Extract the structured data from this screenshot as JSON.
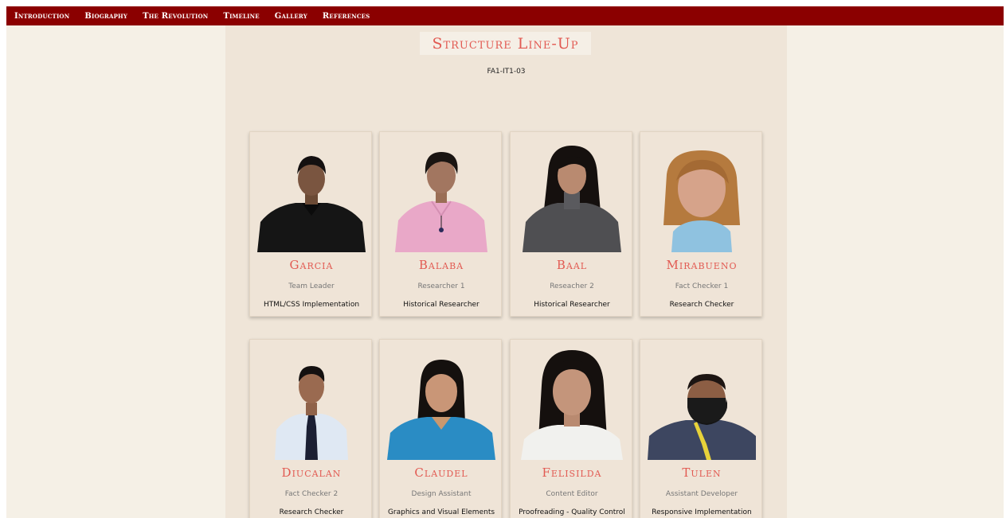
{
  "nav": {
    "items": [
      {
        "label": "Introduction"
      },
      {
        "label": "Biography"
      },
      {
        "label": "The Revolution"
      },
      {
        "label": "Timeline"
      },
      {
        "label": "Gallery"
      },
      {
        "label": "References"
      }
    ]
  },
  "header": {
    "title": "Structure Line-Up",
    "subtitle": "FA1-IT1-03"
  },
  "members": [
    {
      "name": "Garcia",
      "role": "Team Leader",
      "task": "HTML/CSS Implementation"
    },
    {
      "name": "Balaba",
      "role": "Researcher 1",
      "task": "Historical Researcher"
    },
    {
      "name": "Baal",
      "role": "Reseacher 2",
      "task": "Historical Researcher"
    },
    {
      "name": "Mirabueno",
      "role": "Fact Checker 1",
      "task": "Research Checker"
    },
    {
      "name": "Diucalan",
      "role": "Fact Checker 2",
      "task": "Research Checker"
    },
    {
      "name": "Claudel",
      "role": "Design Assistant",
      "task": "Graphics and Visual Elements"
    },
    {
      "name": "Felisilda",
      "role": "Content Editor",
      "task": "Proofreading - Quality Control"
    },
    {
      "name": "Tulen",
      "role": "Assistant Developer",
      "task": "Responsive Implementation"
    }
  ],
  "colors": {
    "nav_bg": "#8b0000",
    "accent": "#e25a52",
    "page_bg": "#f5f0e6",
    "panel_bg": "#efe5d8"
  }
}
